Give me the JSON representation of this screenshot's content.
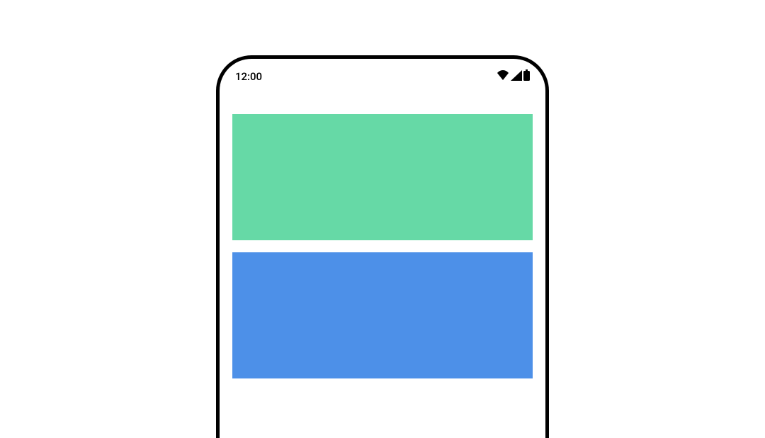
{
  "statusBar": {
    "time": "12:00"
  },
  "blocks": {
    "top": {
      "color": "#66d9a6"
    },
    "bottom": {
      "color": "#4d90e8"
    }
  }
}
